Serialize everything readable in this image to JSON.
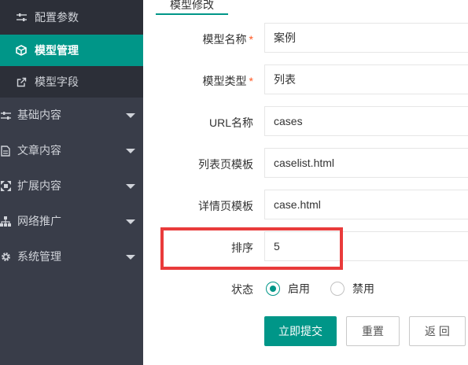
{
  "sidebar": {
    "sub_items": [
      {
        "label": "配置参数",
        "icon": "sliders-icon"
      },
      {
        "label": "模型管理",
        "icon": "cube-icon",
        "active": true
      },
      {
        "label": "模型字段",
        "icon": "external-link-icon"
      }
    ],
    "groups": [
      {
        "label": "基础内容",
        "icon": "sliders-icon"
      },
      {
        "label": "文章内容",
        "icon": "document-icon"
      },
      {
        "label": "扩展内容",
        "icon": "expand-icon"
      },
      {
        "label": "网络推广",
        "icon": "sitemap-icon"
      },
      {
        "label": "系统管理",
        "icon": "gear-icon"
      }
    ]
  },
  "tab": {
    "label": "模型修改"
  },
  "form": {
    "name_label": "模型名称",
    "name_value": "案例",
    "type_label": "模型类型",
    "type_value": "列表",
    "required_mark": "*",
    "url_label": "URL名称",
    "url_value": "cases",
    "list_tpl_label": "列表页模板",
    "list_tpl_value": "caselist.html",
    "detail_tpl_label": "详情页模板",
    "detail_tpl_value": "case.html",
    "sort_label": "排序",
    "sort_value": "5",
    "status_label": "状态",
    "status_options": [
      "启用",
      "禁用"
    ],
    "status_selected": "启用"
  },
  "buttons": {
    "submit": "立即提交",
    "reset": "重置",
    "back": "返 回"
  },
  "colors": {
    "sidebar_bg": "#393d49",
    "accent": "#009688",
    "highlight": "#e93b3b",
    "required": "#ff5722"
  }
}
